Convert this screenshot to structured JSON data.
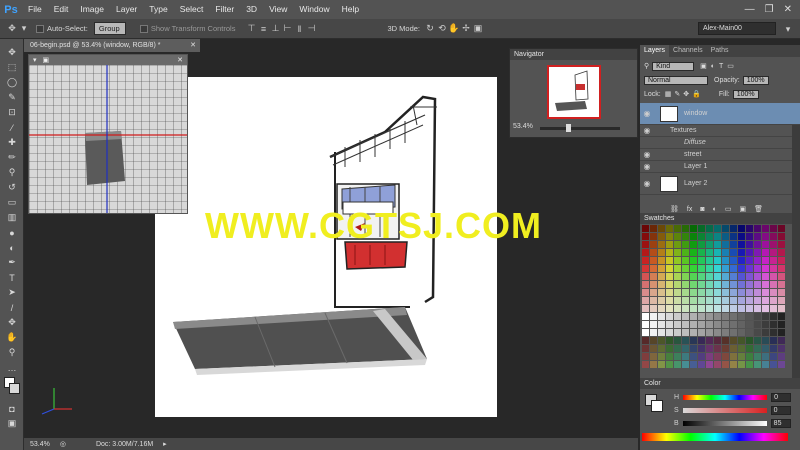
{
  "app": {
    "logo": "Ps"
  },
  "menu": [
    "File",
    "Edit",
    "Image",
    "Layer",
    "Type",
    "Select",
    "Filter",
    "3D",
    "View",
    "Window",
    "Help"
  ],
  "window_controls": {
    "minimize": "—",
    "restore": "❐",
    "close": "✕"
  },
  "options": {
    "auto_select_label": "Auto-Select:",
    "auto_select_value": "Group",
    "transform_label": "Show Transform Controls",
    "mode_3d_label": "3D Mode:",
    "workspace": "Alex-Main00"
  },
  "document": {
    "tab_title": "06-begin.psd @ 53.4% (window, RGB/8) *",
    "zoom": "53.4%",
    "doc_size": "Doc: 3.00M/7.16M"
  },
  "watermark": "WWW.CGTSJ.COM",
  "navigator": {
    "title": "Navigator",
    "zoom": "53.4%",
    "slider_fraction": 0.35
  },
  "layers_panel": {
    "tabs": [
      "Layers",
      "Channels",
      "Paths"
    ],
    "filter": "Kind",
    "blend_mode": "Normal",
    "opacity_label": "Opacity:",
    "opacity": "100%",
    "lock_label": "Lock:",
    "fill_label": "Fill:",
    "fill": "100%",
    "layers": [
      {
        "name": "window",
        "selected": true
      },
      {
        "name": "Textures",
        "indent": 1
      },
      {
        "name": "Diffuse",
        "indent": 2,
        "italic": true
      },
      {
        "name": "street",
        "indent": 2
      },
      {
        "name": "Layer 1",
        "indent": 2
      },
      {
        "name": "Layer 2",
        "indent": 0
      }
    ]
  },
  "swatches": {
    "title": "Swatches"
  },
  "color_panel": {
    "title": "Color",
    "h_label": "H",
    "h_value": "0",
    "s_label": "S",
    "s_value": "0",
    "b_label": "B",
    "b_value": "85"
  }
}
